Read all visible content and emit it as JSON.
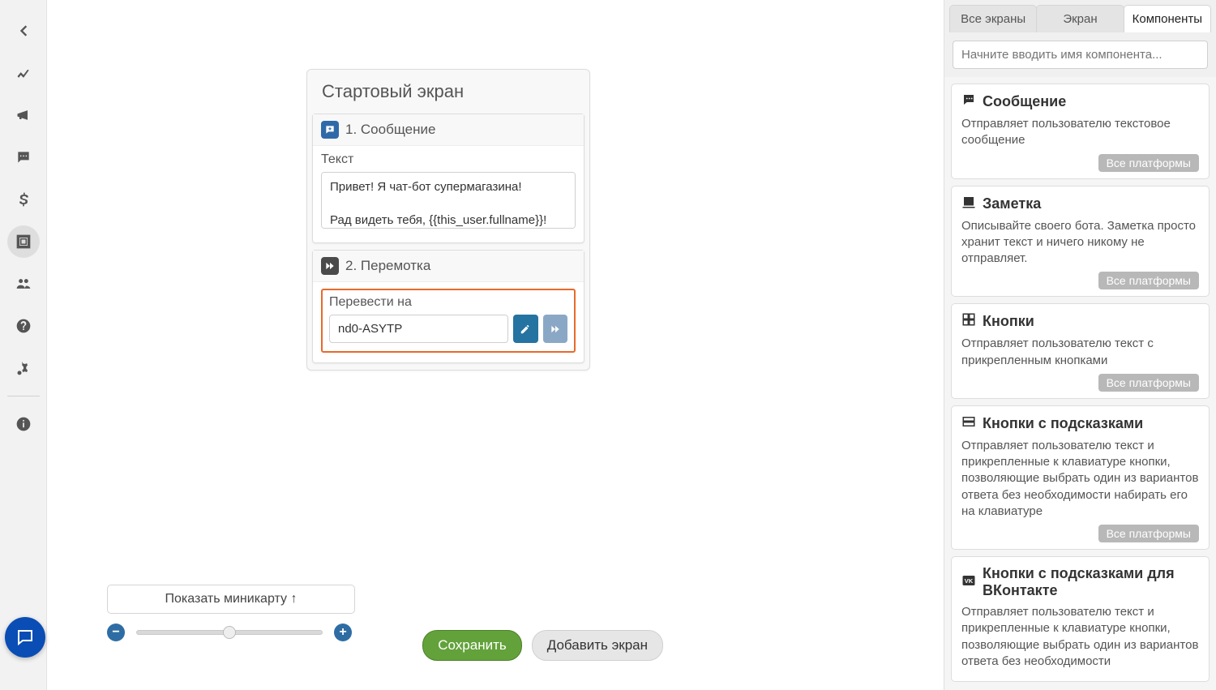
{
  "sidebar_icons": [
    "back",
    "chart",
    "megaphone",
    "chat",
    "dollar",
    "design",
    "users",
    "help",
    "settings",
    "info"
  ],
  "screen": {
    "title": "Стартовый экран",
    "comp1": {
      "header": "1. Сообщение",
      "label": "Текст",
      "text": "Привет! Я чат-бот супермагазина!\n\nРад видеть тебя, {{this_user.fullname}}!"
    },
    "comp2": {
      "header": "2. Перемотка",
      "label": "Перевести на",
      "value": "nd0-ASYTP"
    }
  },
  "controls": {
    "minimap": "Показать миникарту ↑",
    "save": "Сохранить",
    "add_screen": "Добавить экран"
  },
  "right": {
    "tabs": {
      "all": "Все экраны",
      "screen": "Экран",
      "components": "Компоненты"
    },
    "search_placeholder": "Начните вводить имя компонента...",
    "badge": "Все платформы",
    "items": [
      {
        "title": "Сообщение",
        "desc": "Отправляет пользователю текстовое сообщение",
        "icon": "message",
        "badge": true
      },
      {
        "title": "Заметка",
        "desc": "Описывайте своего бота. Заметка просто хранит текст и ничего никому не отправляет.",
        "icon": "note",
        "badge": true
      },
      {
        "title": "Кнопки",
        "desc": "Отправляет пользователю текст с прикрепленным кнопками",
        "icon": "grid",
        "badge": true
      },
      {
        "title": "Кнопки с подсказками",
        "desc": "Отправляет пользователю текст и прикрепленные к клавиатуре кнопки, позволяющие выбрать один из вариантов ответа без необходимости набирать его на клавиатуре",
        "icon": "rows",
        "badge": true
      },
      {
        "title": "Кнопки с подсказками для ВКонтакте",
        "desc": "Отправляет пользователю текст и прикрепленные к клавиатуре кнопки, позволяющие выбрать один из вариантов ответа без необходимости",
        "icon": "vk",
        "badge": false
      }
    ]
  }
}
